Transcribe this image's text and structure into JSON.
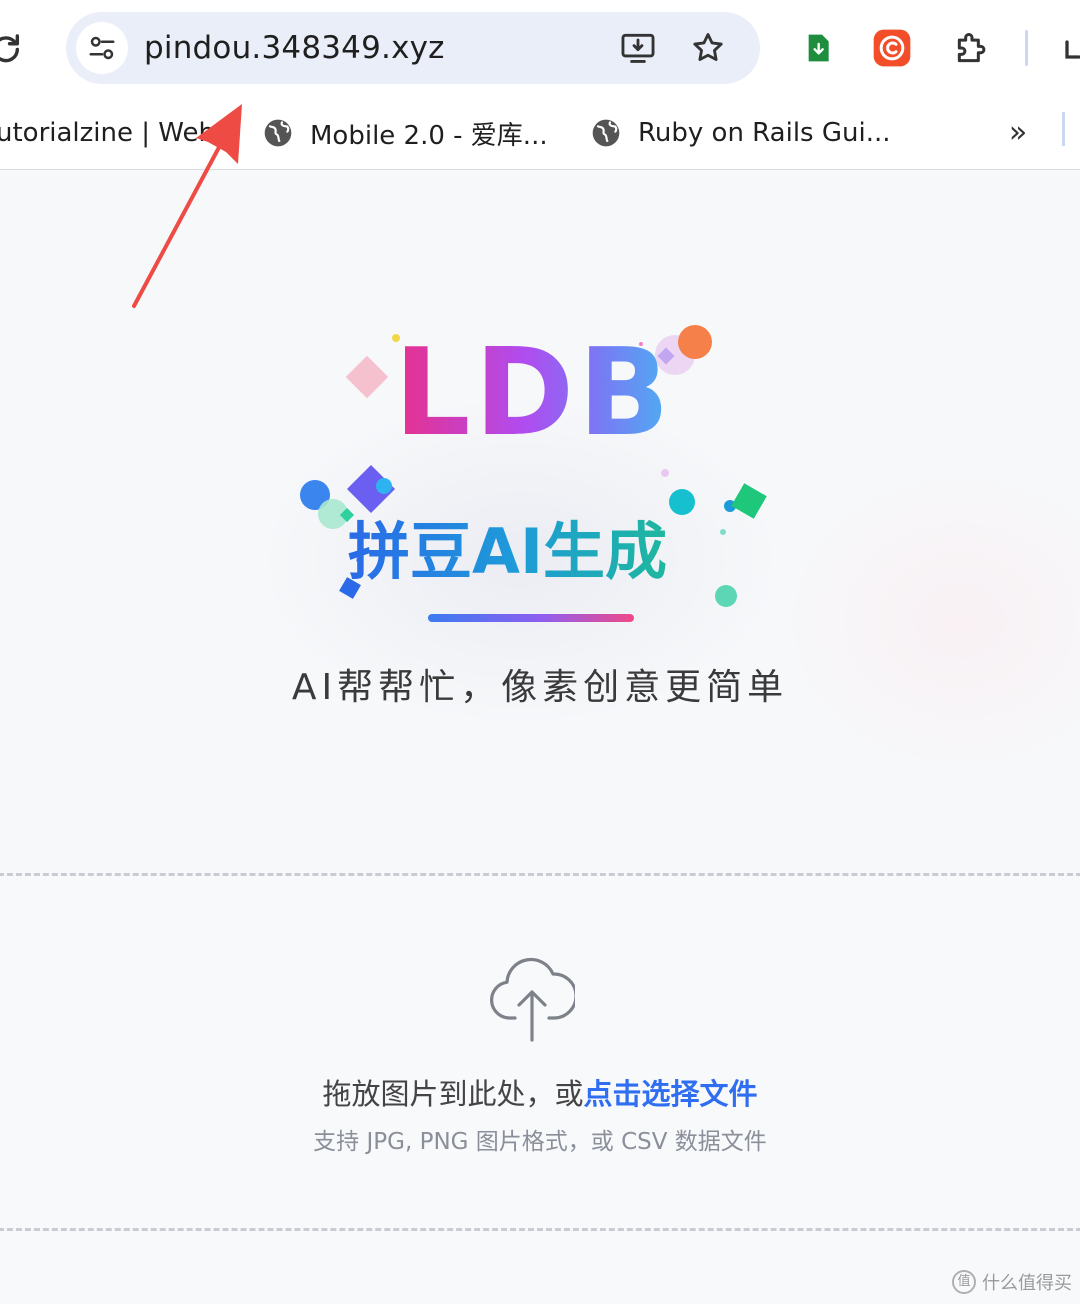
{
  "browser": {
    "url": "pindou.348349.xyz",
    "bookmarks": [
      {
        "label": "utorialzine | Web..."
      },
      {
        "label": "Mobile 2.0 - 爱库..."
      },
      {
        "label": "Ruby on Rails Gui..."
      }
    ],
    "more_label": "»",
    "icons": {
      "reload": "reload-icon",
      "site_info": "tune-icon",
      "install": "install-app-icon",
      "bookmark": "star-icon",
      "ext1": "green-download-extension-icon",
      "ext2": "orange-copyright-extension-icon",
      "extensions": "puzzle-icon"
    }
  },
  "hero": {
    "logo": "LDB",
    "subtitle": "拼豆AI生成",
    "tagline": "AI帮帮忙，像素创意更简单"
  },
  "upload": {
    "prompt_text": "拖放图片到此处，或",
    "prompt_link": "点击选择文件",
    "hint": "支持 JPG, PNG 图片格式，或 CSV 数据文件",
    "icon": "cloud-upload-icon"
  },
  "watermark": {
    "text": "什么值得买"
  },
  "colors": {
    "link": "#2f6ef0",
    "logo_gradient": [
      "#e8308c",
      "#b04cf0",
      "#45b8f2"
    ],
    "subtitle_gradient": [
      "#2a6ae8",
      "#1fc18a"
    ],
    "annotation_arrow": "#ee4b45"
  }
}
